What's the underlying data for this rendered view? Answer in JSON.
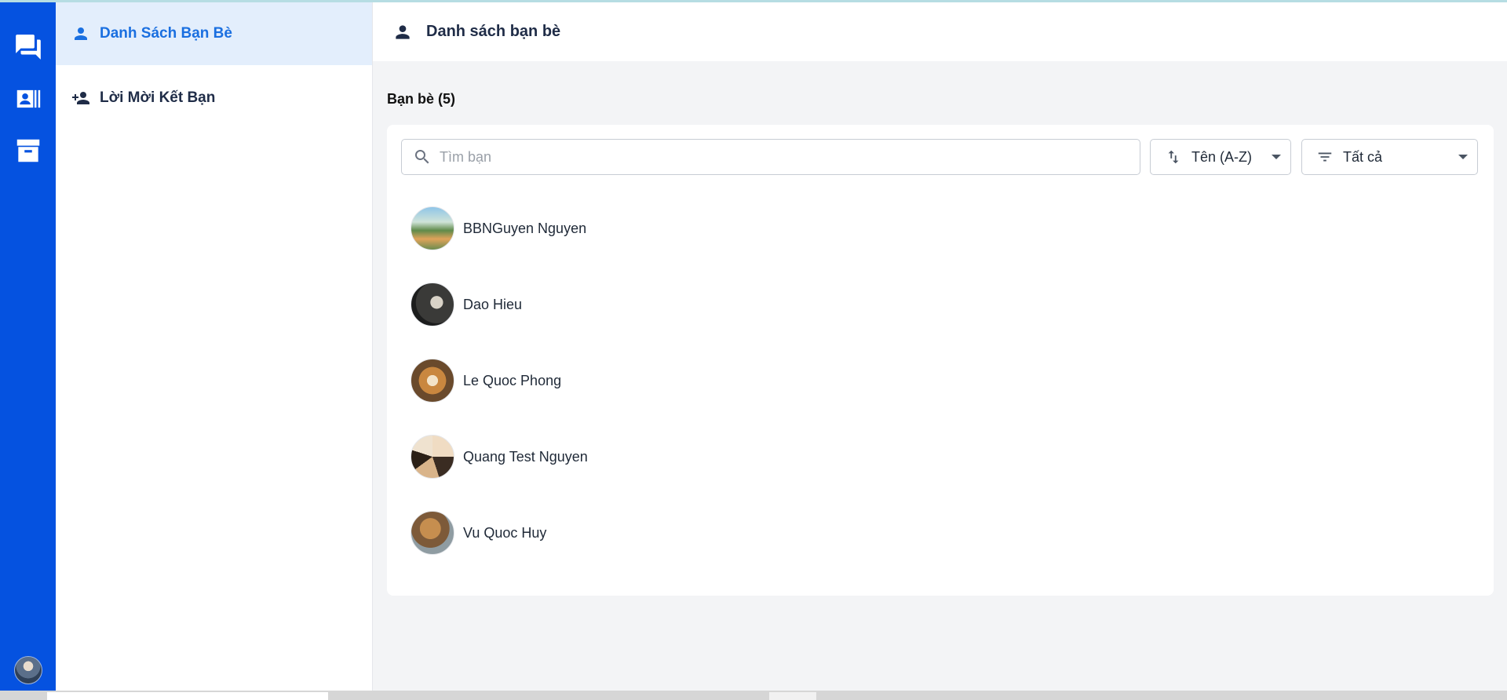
{
  "rail": {
    "items": [
      {
        "icon": "chat-icon"
      },
      {
        "icon": "contacts-icon"
      },
      {
        "icon": "archive-icon"
      }
    ],
    "avatar_icon": "user-avatar"
  },
  "sidebar": {
    "items": [
      {
        "label": "Danh Sách Bạn Bè",
        "icon": "person-icon",
        "active": true
      },
      {
        "label": "Lời Mời Kết Bạn",
        "icon": "person-add-icon",
        "active": false
      }
    ]
  },
  "header": {
    "title": "Danh sách bạn bè",
    "icon": "person-icon"
  },
  "main": {
    "count_label": "Bạn bè (5)",
    "search": {
      "placeholder": "Tìm bạn",
      "value": ""
    },
    "sort": {
      "value": "Tên (A-Z)",
      "icon": "sort-icon"
    },
    "filter": {
      "value": "Tất cả",
      "icon": "filter-icon"
    },
    "friends": [
      {
        "name": "BBNGuyen Nguyen"
      },
      {
        "name": "Dao Hieu"
      },
      {
        "name": "Le Quoc Phong"
      },
      {
        "name": "Quang Test Nguyen"
      },
      {
        "name": "Vu Quoc Huy"
      }
    ]
  },
  "colors": {
    "rail": "#0552e0",
    "accent": "#1a6fe0",
    "active_bg": "#e3eefc",
    "text_dark": "#1f2c47",
    "page_bg": "#f3f4f6"
  }
}
